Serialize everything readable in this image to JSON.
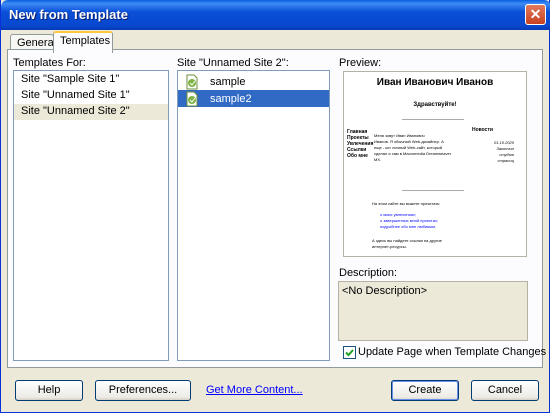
{
  "window": {
    "title": "New from Template"
  },
  "tabs": [
    {
      "label": "General"
    },
    {
      "label": "Templates"
    }
  ],
  "templates_for": {
    "label": "Templates For:",
    "items": [
      "Site \"Sample Site 1\"",
      "Site \"Unnamed Site 1\"",
      "Site \"Unnamed Site 2\""
    ],
    "selected": 2
  },
  "site": {
    "label": "Site \"Unnamed Site 2\":",
    "items": [
      "sample",
      "sample2"
    ],
    "selected": 1
  },
  "preview": {
    "label": "Preview:",
    "heading": "Иван Иванович Иванов",
    "greeting": "Здравствуйте!",
    "nav": [
      "Главная",
      "Проекты",
      "Увлечения",
      "Ссылки",
      "Обо мне"
    ],
    "intro_lines": [
      "Меня зовут Иван Иванович",
      "Иванов. Я обычный Web-дизайнер. А",
      "еще - кот личный Web-сайт, который",
      "сделал я сам в Macromedia Dreamweaver",
      "MX."
    ],
    "news_title": "Новости",
    "news_lines": [
      "01.10.2020",
      "Закончил",
      "студию",
      "страниц"
    ],
    "links_intro": "На этом сайте вы можете прочитать:",
    "links": [
      "о моих увлечениях;",
      "о завершенных мной проектах;",
      "подробнее обо мне любимом."
    ],
    "footer_line": "А здесь вы найдете ссылки на другие",
    "footer_line2": "интернет-ресурсы."
  },
  "description": {
    "label": "Description:",
    "value": "<No Description>"
  },
  "update_checkbox": {
    "label": "Update Page when Template Changes",
    "checked": true
  },
  "buttons": {
    "help": "Help",
    "preferences": "Preferences...",
    "get_more": "Get More Content...",
    "create": "Create",
    "cancel": "Cancel"
  },
  "colors": {
    "titlebar": "#0a4fd8",
    "selection": "#316ac5",
    "link": "#0000ff"
  }
}
